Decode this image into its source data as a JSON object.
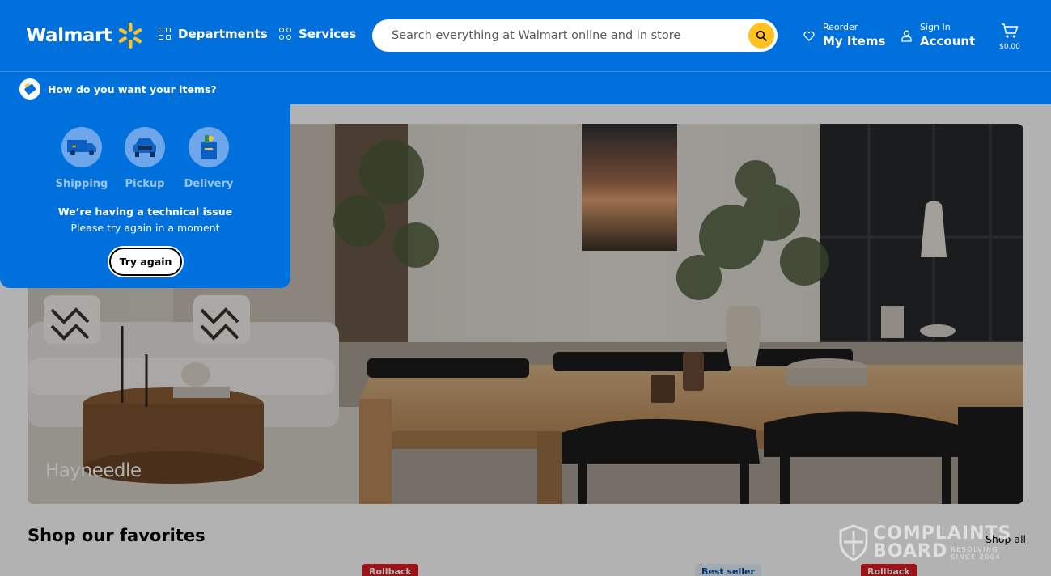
{
  "header": {
    "logo_text": "Walmart",
    "departments_label": "Departments",
    "services_label": "Services",
    "search_placeholder": "Search everything at Walmart online and in store",
    "reorder_small": "Reorder",
    "reorder_big": "My Items",
    "signin_small": "Sign In",
    "signin_big": "Account",
    "cart_amount": "$0.00"
  },
  "subbar": {
    "prompt": "How do you want your items?"
  },
  "fulfillment_popup": {
    "options": [
      {
        "label": "Shipping",
        "icon": "shipping-truck-icon"
      },
      {
        "label": "Pickup",
        "icon": "pickup-car-icon"
      },
      {
        "label": "Delivery",
        "icon": "delivery-bag-icon"
      }
    ],
    "error_title": "We’re having a technical issue",
    "error_subtitle": "Please try again in a moment",
    "retry_label": "Try again"
  },
  "hero": {
    "brand": "Hayneedle"
  },
  "favorites": {
    "title": "Shop our favorites",
    "shop_all": "Shop all",
    "tags": [
      "Rollback",
      "Best seller",
      "Rollback"
    ]
  },
  "watermark": {
    "line1": "COMPLAINTS",
    "line2": "BOARD",
    "tag1": "RESOLVING",
    "tag2": "SINCE 2004"
  },
  "colors": {
    "brand_blue": "#0071dc",
    "spark_yellow": "#ffc220",
    "rollback_red": "#de1c24"
  }
}
